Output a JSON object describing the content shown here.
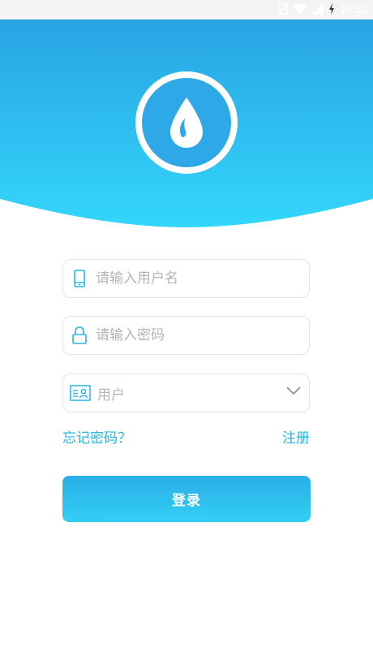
{
  "status": {
    "time": "10:52"
  },
  "login": {
    "username_placeholder": "请输入用户名",
    "password_placeholder": "请输入密码",
    "role_value": "用户",
    "forgot_password": "忘记密码？",
    "register": "注册",
    "login_button": "登录"
  },
  "colors": {
    "accent": "#25b6e6",
    "header_top": "#29a4e3",
    "header_bottom": "#33d6fb"
  },
  "icons": [
    "water-drop-icon",
    "phone-icon",
    "lock-icon",
    "id-card-icon",
    "chevron-down-icon",
    "wifi-icon",
    "signal-icon",
    "battery-icon"
  ]
}
